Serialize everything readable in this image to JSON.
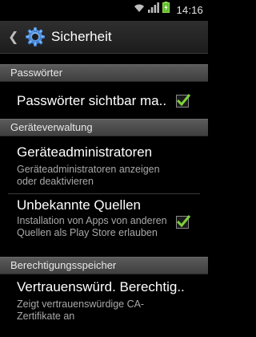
{
  "status_bar": {
    "time": "14:16",
    "icons": [
      "wifi-icon",
      "signal-icon",
      "battery-charging-icon"
    ]
  },
  "action_bar": {
    "back_icon": "chevron-left-icon",
    "app_icon": "settings-gear-icon",
    "title": "Sicherheit"
  },
  "sections": [
    {
      "header": "Passwörter",
      "items": [
        {
          "title": "Passwörter sichtbar ma..",
          "summary": "",
          "checked": true
        }
      ]
    },
    {
      "header": "Geräteverwaltung",
      "items": [
        {
          "title": "Geräteadministratoren",
          "summary": "Geräteadministratoren anzeigen oder deaktivieren"
        },
        {
          "title": "Unbekannte Quellen",
          "summary": "Installation von Apps von anderen Quellen als Play Store erlauben",
          "checked": true
        }
      ]
    },
    {
      "header": "Berechtigungsspeicher",
      "items": [
        {
          "title": "Vertrauenswürd. Berechtig..",
          "summary": "Zeigt vertrauenswürdige CA-Zertifikate an"
        }
      ]
    }
  ],
  "colors": {
    "accent_check": "#7fd13b",
    "header_bg": "#4a4a4a",
    "summary_text": "#a9a9a9"
  }
}
